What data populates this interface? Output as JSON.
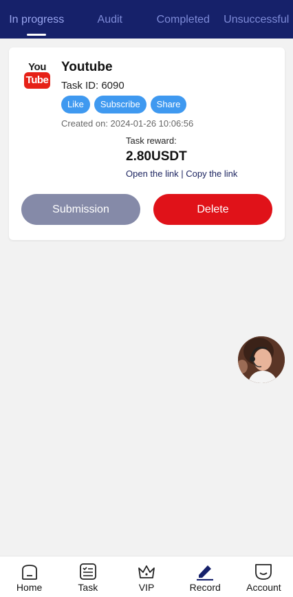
{
  "tabs": [
    {
      "label": "In progress",
      "active": true
    },
    {
      "label": "Audit",
      "active": false
    },
    {
      "label": "Completed",
      "active": false
    },
    {
      "label": "Unsuccessful",
      "active": false
    }
  ],
  "task": {
    "logo_top": "You",
    "logo_bottom": "Tube",
    "title": "Youtube",
    "task_id": "Task ID: 6090",
    "actions": [
      "Like",
      "Subscribe",
      "Share"
    ],
    "created": "Created on: 2024-01-26 10:06:56",
    "reward_label": "Task reward:",
    "reward_value": "2.80USDT",
    "open_link": "Open the link",
    "separator": " | ",
    "copy_link": "Copy the link",
    "submit_label": "Submission",
    "delete_label": "Delete"
  },
  "nav": [
    {
      "label": "Home",
      "icon": "home-icon"
    },
    {
      "label": "Task",
      "icon": "task-icon"
    },
    {
      "label": "VIP",
      "icon": "crown-icon"
    },
    {
      "label": "Record",
      "icon": "pen-icon"
    },
    {
      "label": "Account",
      "icon": "account-icon"
    }
  ],
  "colors": {
    "header_bg": "#16216a",
    "pill": "#3f99f0",
    "submit": "#858aa8",
    "delete": "#e01219"
  }
}
